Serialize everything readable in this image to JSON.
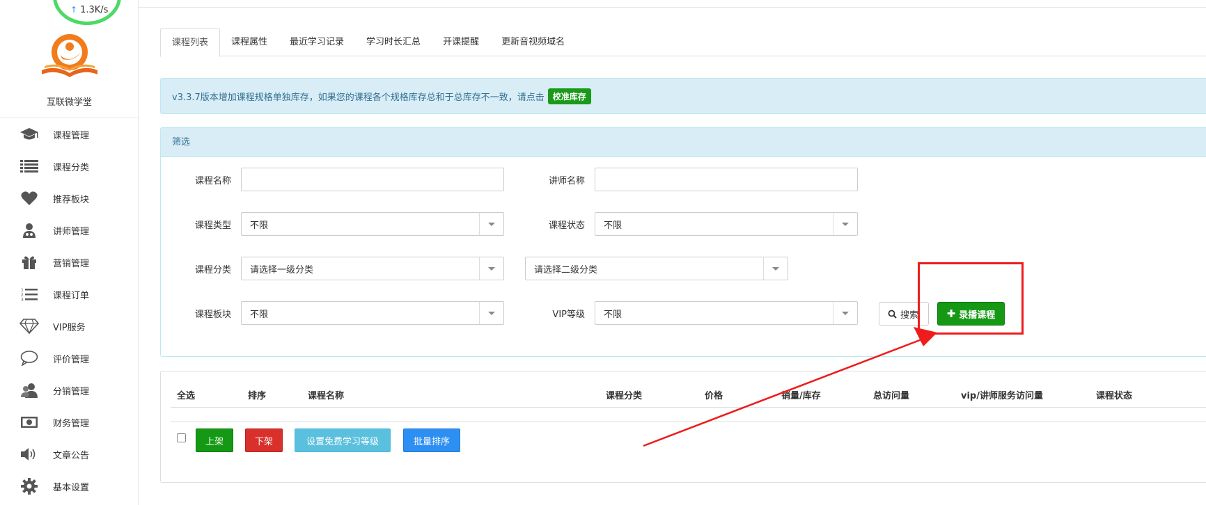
{
  "speed": {
    "value": "1.3K/s"
  },
  "sidebar": {
    "brand": "互联微学堂",
    "items": [
      {
        "label": "课程管理",
        "icon": "graduation-cap-icon"
      },
      {
        "label": "课程分类",
        "icon": "list-icon"
      },
      {
        "label": "推荐板块",
        "icon": "heart-icon"
      },
      {
        "label": "讲师管理",
        "icon": "user-md-icon"
      },
      {
        "label": "营销管理",
        "icon": "gift-icon"
      },
      {
        "label": "课程订单",
        "icon": "list-ol-icon"
      },
      {
        "label": "VIP服务",
        "icon": "diamond-icon"
      },
      {
        "label": "评价管理",
        "icon": "comment-icon"
      },
      {
        "label": "分销管理",
        "icon": "users-icon"
      },
      {
        "label": "财务管理",
        "icon": "money-icon"
      },
      {
        "label": "文章公告",
        "icon": "volume-icon"
      },
      {
        "label": "基本设置",
        "icon": "gear-icon"
      }
    ]
  },
  "tabs": [
    "课程列表",
    "课程属性",
    "最近学习记录",
    "学习时长汇总",
    "开课提醒",
    "更新音视频域名"
  ],
  "alert": {
    "text": "v3.3.7版本增加课程规格单独库存，如果您的课程各个规格库存总和于总库存不一致，请点击",
    "button": "校准库存"
  },
  "filter": {
    "title": "筛选",
    "course_name_label": "课程名称",
    "teacher_name_label": "讲师名称",
    "course_type_label": "课程类型",
    "course_type_value": "不限",
    "course_status_label": "课程状态",
    "course_status_value": "不限",
    "course_category_label": "课程分类",
    "category_level1_value": "请选择一级分类",
    "category_level2_value": "请选择二级分类",
    "course_block_label": "课程板块",
    "course_block_value": "不限",
    "vip_level_label": "VIP等级",
    "vip_level_value": "不限",
    "search_button": "搜索",
    "record_button": "录播课程"
  },
  "table": {
    "columns": [
      "全选",
      "排序",
      "课程名称",
      "课程分类",
      "价格",
      "销量/库存",
      "总访问量",
      "vip/讲师服务访问量",
      "课程状态"
    ],
    "actions": {
      "shelve": "上架",
      "unshelve": "下架",
      "free_level": "设置免费学习等级",
      "batch_sort": "批量排序"
    }
  },
  "colors": {
    "green": "#159915",
    "red": "#d9302c",
    "info": "#5bc0de",
    "primary": "#2e8ff2",
    "highlight": "#ee1c1c"
  }
}
